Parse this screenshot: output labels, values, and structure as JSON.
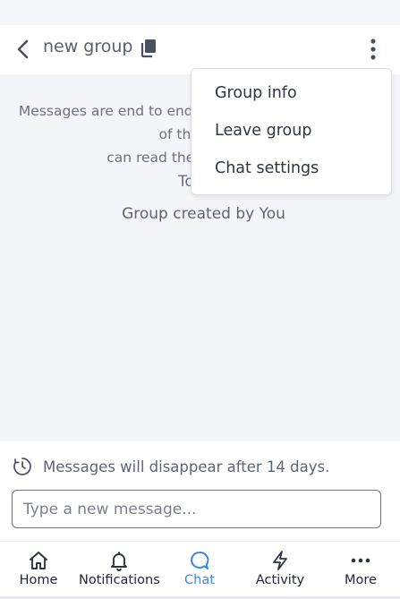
{
  "header": {
    "title": "new group"
  },
  "chat": {
    "encryption_notice_line1": "Messages are end to end encrypted. No one outside of this chat,",
    "encryption_notice_line2": "can read them except you.",
    "date_label": "Today",
    "system_message": "Group created by You"
  },
  "menu": {
    "items": [
      "Group info",
      "Leave group",
      "Chat settings"
    ]
  },
  "composer": {
    "disappear_notice": "Messages will disappear after 14 days.",
    "placeholder": "Type a new message..."
  },
  "nav": {
    "items": [
      {
        "label": "Home",
        "icon": "home-icon"
      },
      {
        "label": "Notifications",
        "icon": "bell-icon"
      },
      {
        "label": "Chat",
        "icon": "chat-bubble-icon",
        "active": true
      },
      {
        "label": "Activity",
        "icon": "lightning-icon"
      },
      {
        "label": "More",
        "icon": "more-dots-icon"
      }
    ],
    "active_color": "#3f86d9"
  }
}
